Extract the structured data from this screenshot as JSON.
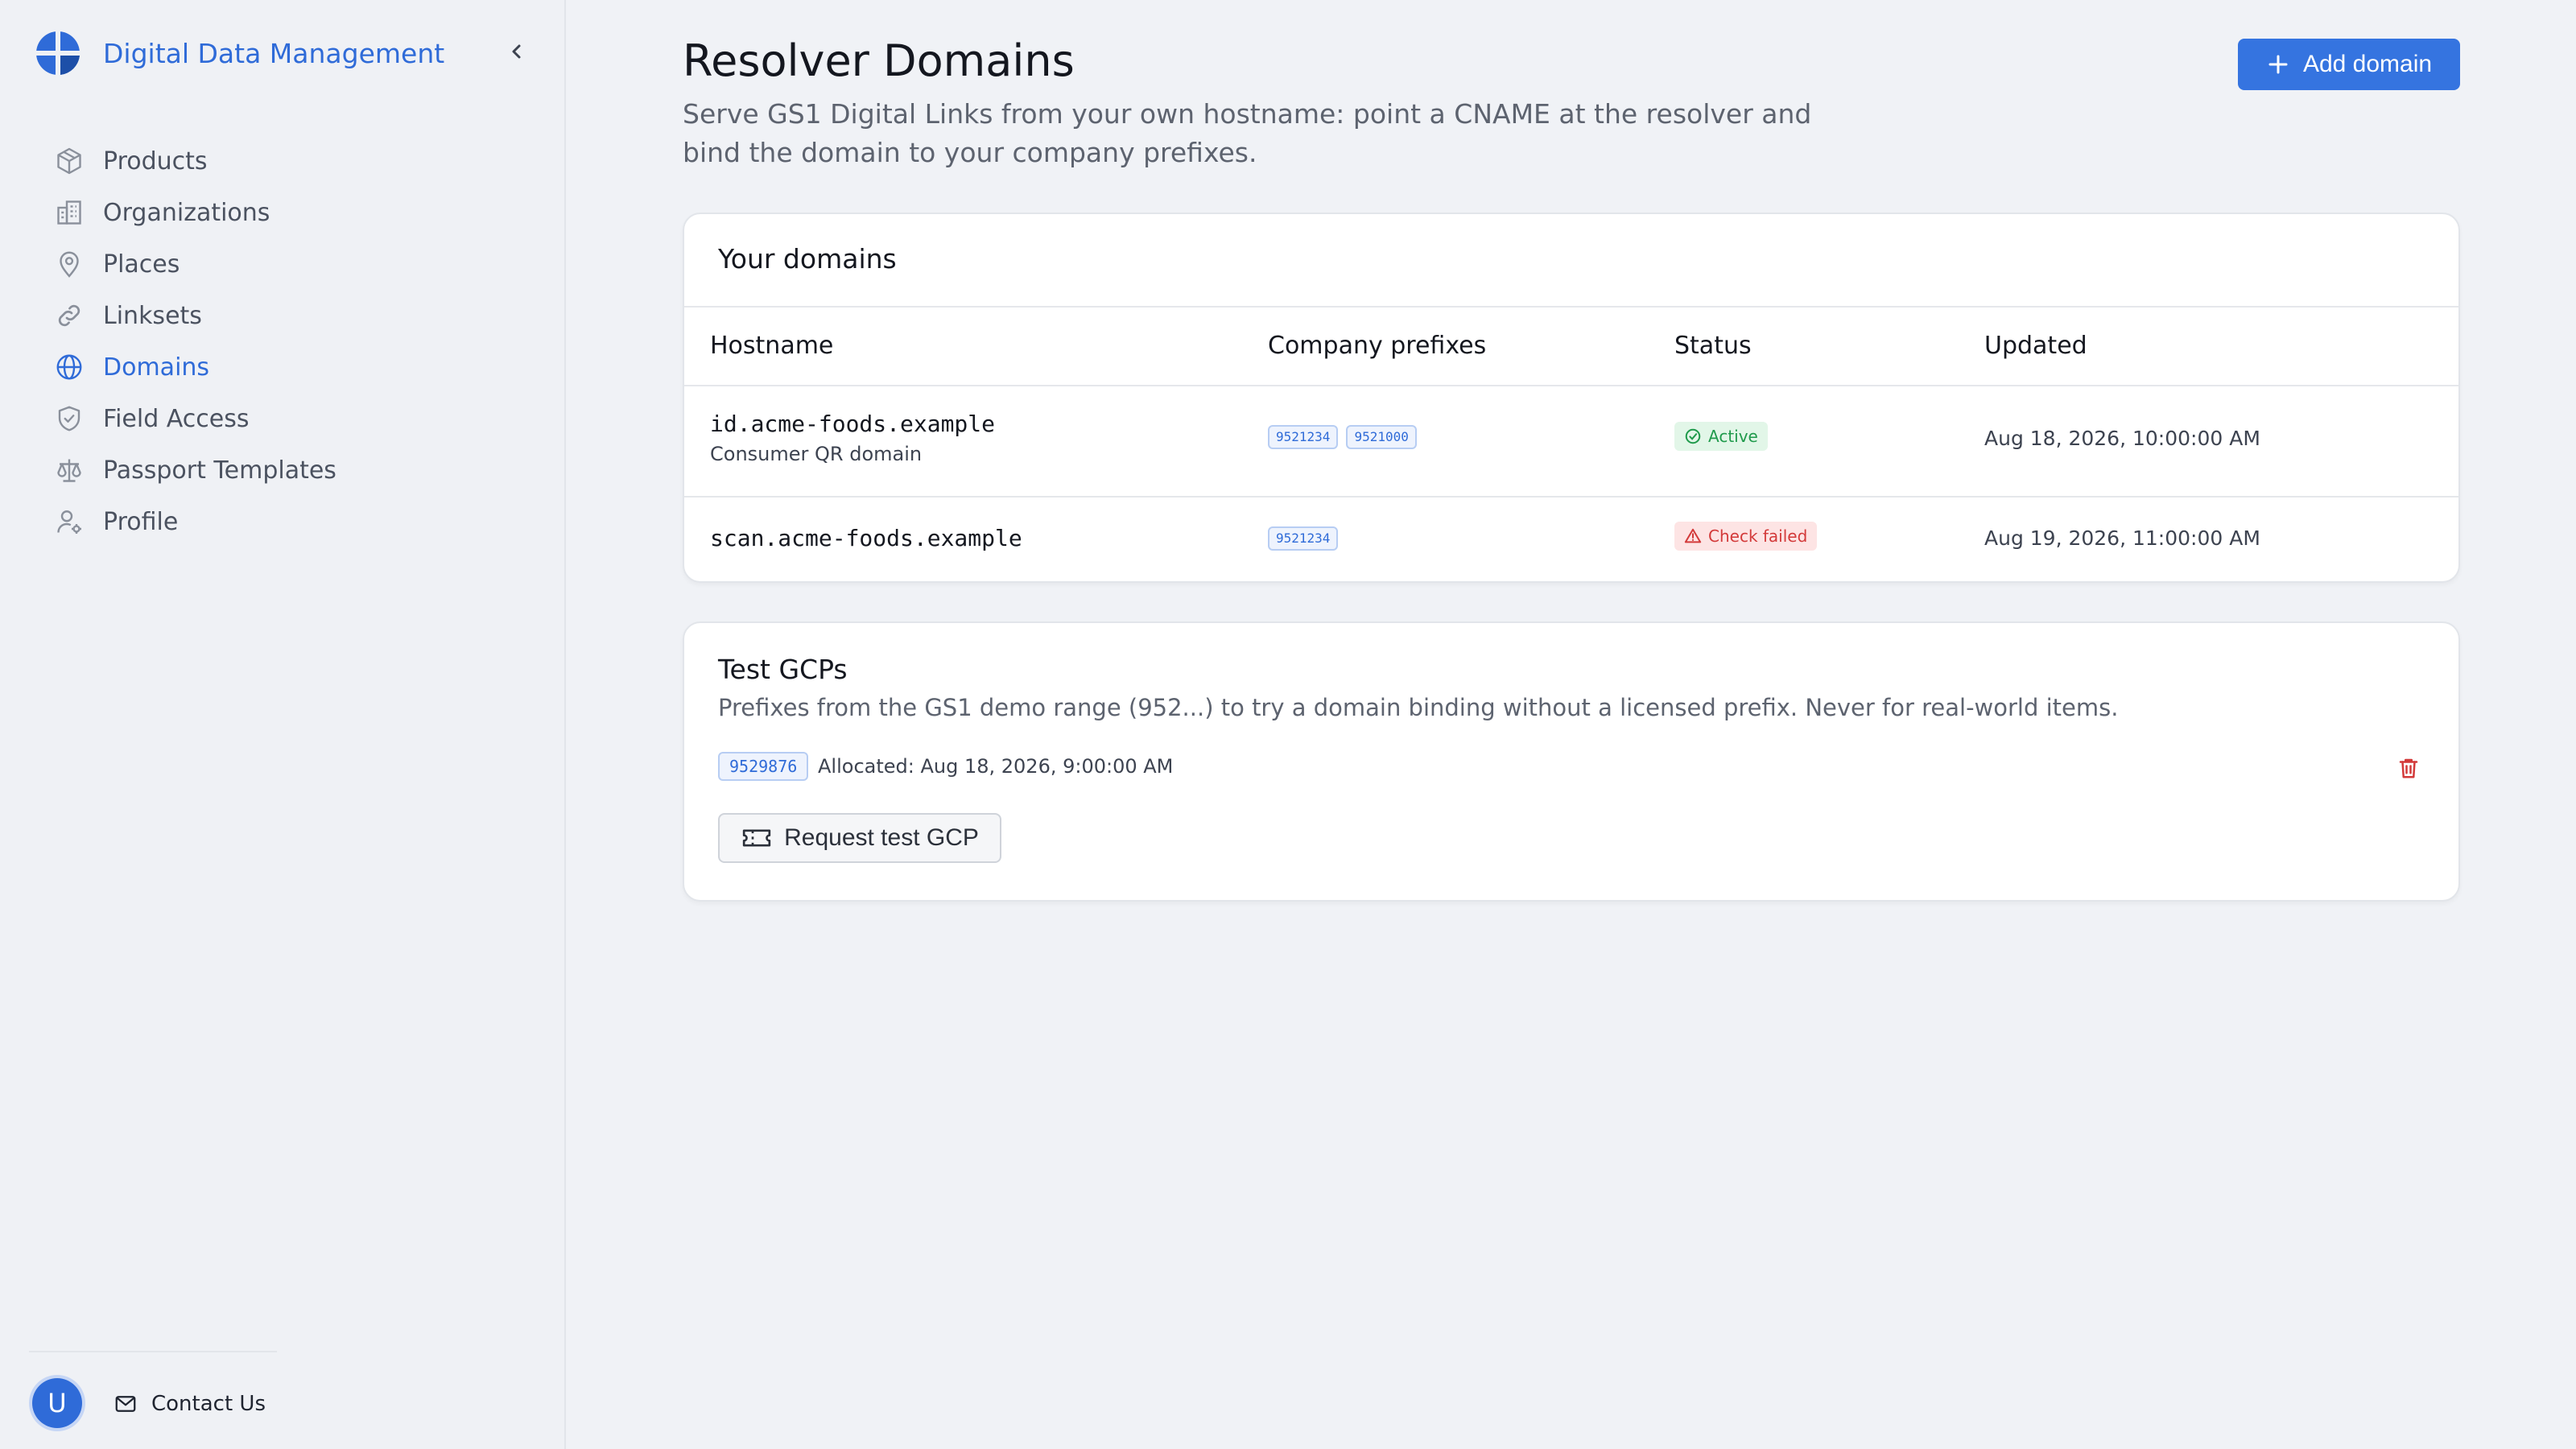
{
  "app": {
    "name": "Digital Data Management"
  },
  "sidebar": {
    "items": [
      {
        "label": "Products",
        "icon": "box-icon",
        "active": false
      },
      {
        "label": "Organizations",
        "icon": "building-icon",
        "active": false
      },
      {
        "label": "Places",
        "icon": "map-pin-icon",
        "active": false
      },
      {
        "label": "Linksets",
        "icon": "link-icon",
        "active": false
      },
      {
        "label": "Domains",
        "icon": "globe-icon",
        "active": true
      },
      {
        "label": "Field Access",
        "icon": "shield-icon",
        "active": false
      },
      {
        "label": "Passport Templates",
        "icon": "scale-icon",
        "active": false
      },
      {
        "label": "Profile",
        "icon": "user-gear-icon",
        "active": false
      }
    ],
    "avatar_initial": "U",
    "contact_label": "Contact Us"
  },
  "header": {
    "title": "Resolver Domains",
    "description": "Serve GS1 Digital Links from your own hostname: point a CNAME at the resolver and bind the domain to your company prefixes.",
    "add_button": "Add domain"
  },
  "domains_card": {
    "title": "Your domains",
    "columns": [
      "Hostname",
      "Company prefixes",
      "Status",
      "Updated"
    ],
    "rows": [
      {
        "hostname": "id.acme-foods.example",
        "note": "Consumer QR domain",
        "prefixes": [
          "9521234",
          "9521000"
        ],
        "status": "Active",
        "updated": "Aug 18, 2026, 10:00:00 AM"
      },
      {
        "hostname": "scan.acme-foods.example",
        "note": "",
        "prefixes": [
          "9521234"
        ],
        "status": "Check failed",
        "updated": "Aug 19, 2026, 11:00:00 AM"
      }
    ]
  },
  "test_card": {
    "title": "Test GCPs",
    "description": "Prefixes from the GS1 demo range (952...) to try a domain binding without a licensed prefix. Never for real-world items.",
    "gcp": "9529876",
    "allocated": "Allocated: Aug 18, 2026, 9:00:00 AM",
    "request_button": "Request test GCP"
  },
  "colors": {
    "accent": "#2f6bd8",
    "button": "#3574e0",
    "success": "#1f9a4b",
    "danger": "#d33a3a"
  }
}
